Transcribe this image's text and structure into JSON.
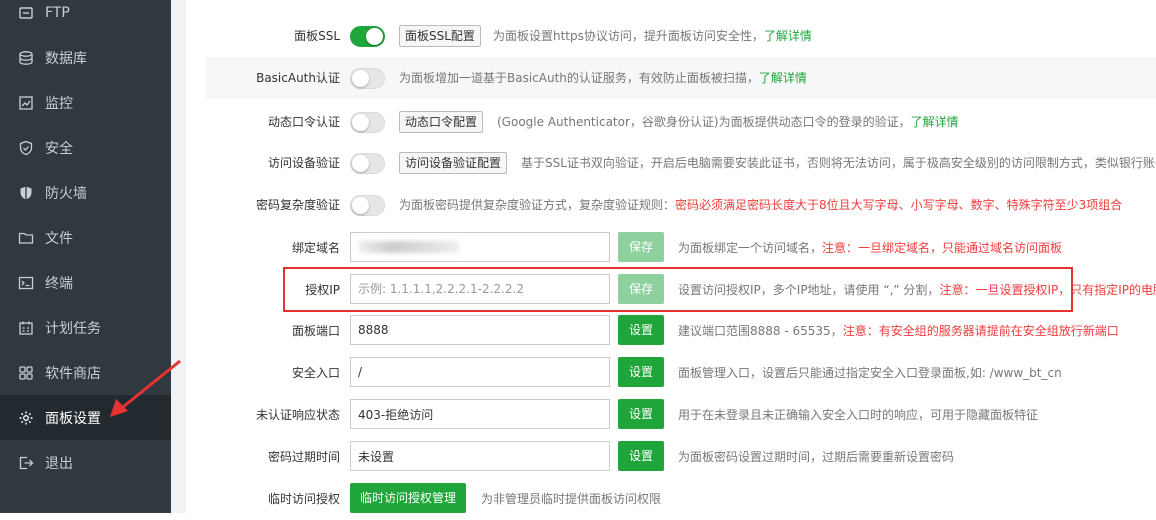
{
  "sidebar": {
    "items": [
      {
        "label": "FTP",
        "icon": "ftp-icon"
      },
      {
        "label": "数据库",
        "icon": "database-icon"
      },
      {
        "label": "监控",
        "icon": "monitor-icon"
      },
      {
        "label": "安全",
        "icon": "shield-icon"
      },
      {
        "label": "防火墙",
        "icon": "firewall-icon"
      },
      {
        "label": "文件",
        "icon": "folder-icon"
      },
      {
        "label": "终端",
        "icon": "terminal-icon"
      },
      {
        "label": "计划任务",
        "icon": "calendar-icon"
      },
      {
        "label": "软件商店",
        "icon": "apps-icon"
      },
      {
        "label": "面板设置",
        "icon": "gear-icon"
      },
      {
        "label": "退出",
        "icon": "logout-icon"
      }
    ],
    "active_index": 9
  },
  "settings": {
    "ssl": {
      "label": "面板SSL",
      "button": "面板SSL配置",
      "desc": "为面板设置https协议访问，提升面板访问安全性，",
      "link": "了解详情"
    },
    "basicauth": {
      "label": "BasicAuth认证",
      "desc": "为面板增加一道基于BasicAuth的认证服务，有效防止面板被扫描，",
      "link": "了解详情"
    },
    "dynamic": {
      "label": "动态口令认证",
      "button": "动态口令配置",
      "desc": "(Google Authenticator，谷歌身份认证)为面板提供动态口令的登录的验证，",
      "link": "了解详情"
    },
    "device": {
      "label": "访问设备验证",
      "button": "访问设备验证配置",
      "desc": "基于SSL证书双向验证，开启后电脑需要安装此证书，否则将无法访问，属于极高安全级别的访问限制方式，类似银行账号"
    },
    "complexity": {
      "label": "密码复杂度验证",
      "desc": "为面板密码提供复杂度验证方式，复杂度验证规则：",
      "red": "密码必须满足密码长度大于8位且大写字母、小写字母、数字、特殊字符至少3项组合"
    },
    "domain": {
      "label": "绑定域名",
      "value": "",
      "button": "保存",
      "desc": "为面板绑定一个访问域名，",
      "red": "注意：一旦绑定域名，只能通过域名访问面板"
    },
    "auth_ip": {
      "label": "授权IP",
      "placeholder": "示例: 1.1.1.1,2.2.2.1-2.2.2.2",
      "button": "保存",
      "desc": "设置访问授权IP，多个IP地址，请使用 “,” 分割，",
      "red": "注意：一旦设置授权IP，只有指定IP的电脑"
    },
    "port": {
      "label": "面板端口",
      "value": "8888",
      "button": "设置",
      "desc": "建议端口范围8888 - 65535，",
      "red": "注意：有安全组的服务器请提前在安全组放行新端口"
    },
    "entry": {
      "label": "安全入口",
      "value": "/",
      "button": "设置",
      "desc": "面板管理入口，设置后只能通过指定安全入口登录面板,如: /www_bt_cn"
    },
    "unauth": {
      "label": "未认证响应状态",
      "value": "403-拒绝访问",
      "button": "设置",
      "desc": "用于在未登录且未正确输入安全入口时的响应，可用于隐藏面板特征"
    },
    "expire": {
      "label": "密码过期时间",
      "value": "未设置",
      "button": "设置",
      "desc": "为面板密码设置过期时间，过期后需要重新设置密码"
    },
    "temp": {
      "label": "临时访问授权",
      "button": "临时访问授权管理",
      "desc": "为非管理员临时提供面板访问权限"
    }
  },
  "toggles": {
    "ssl": true,
    "basicauth": false,
    "dynamic": false,
    "device": false,
    "complexity": false
  },
  "colors": {
    "sidebar": "#30393f",
    "accent": "#20a53a",
    "warning": "#f03c3c",
    "annotation": "#e53333"
  }
}
